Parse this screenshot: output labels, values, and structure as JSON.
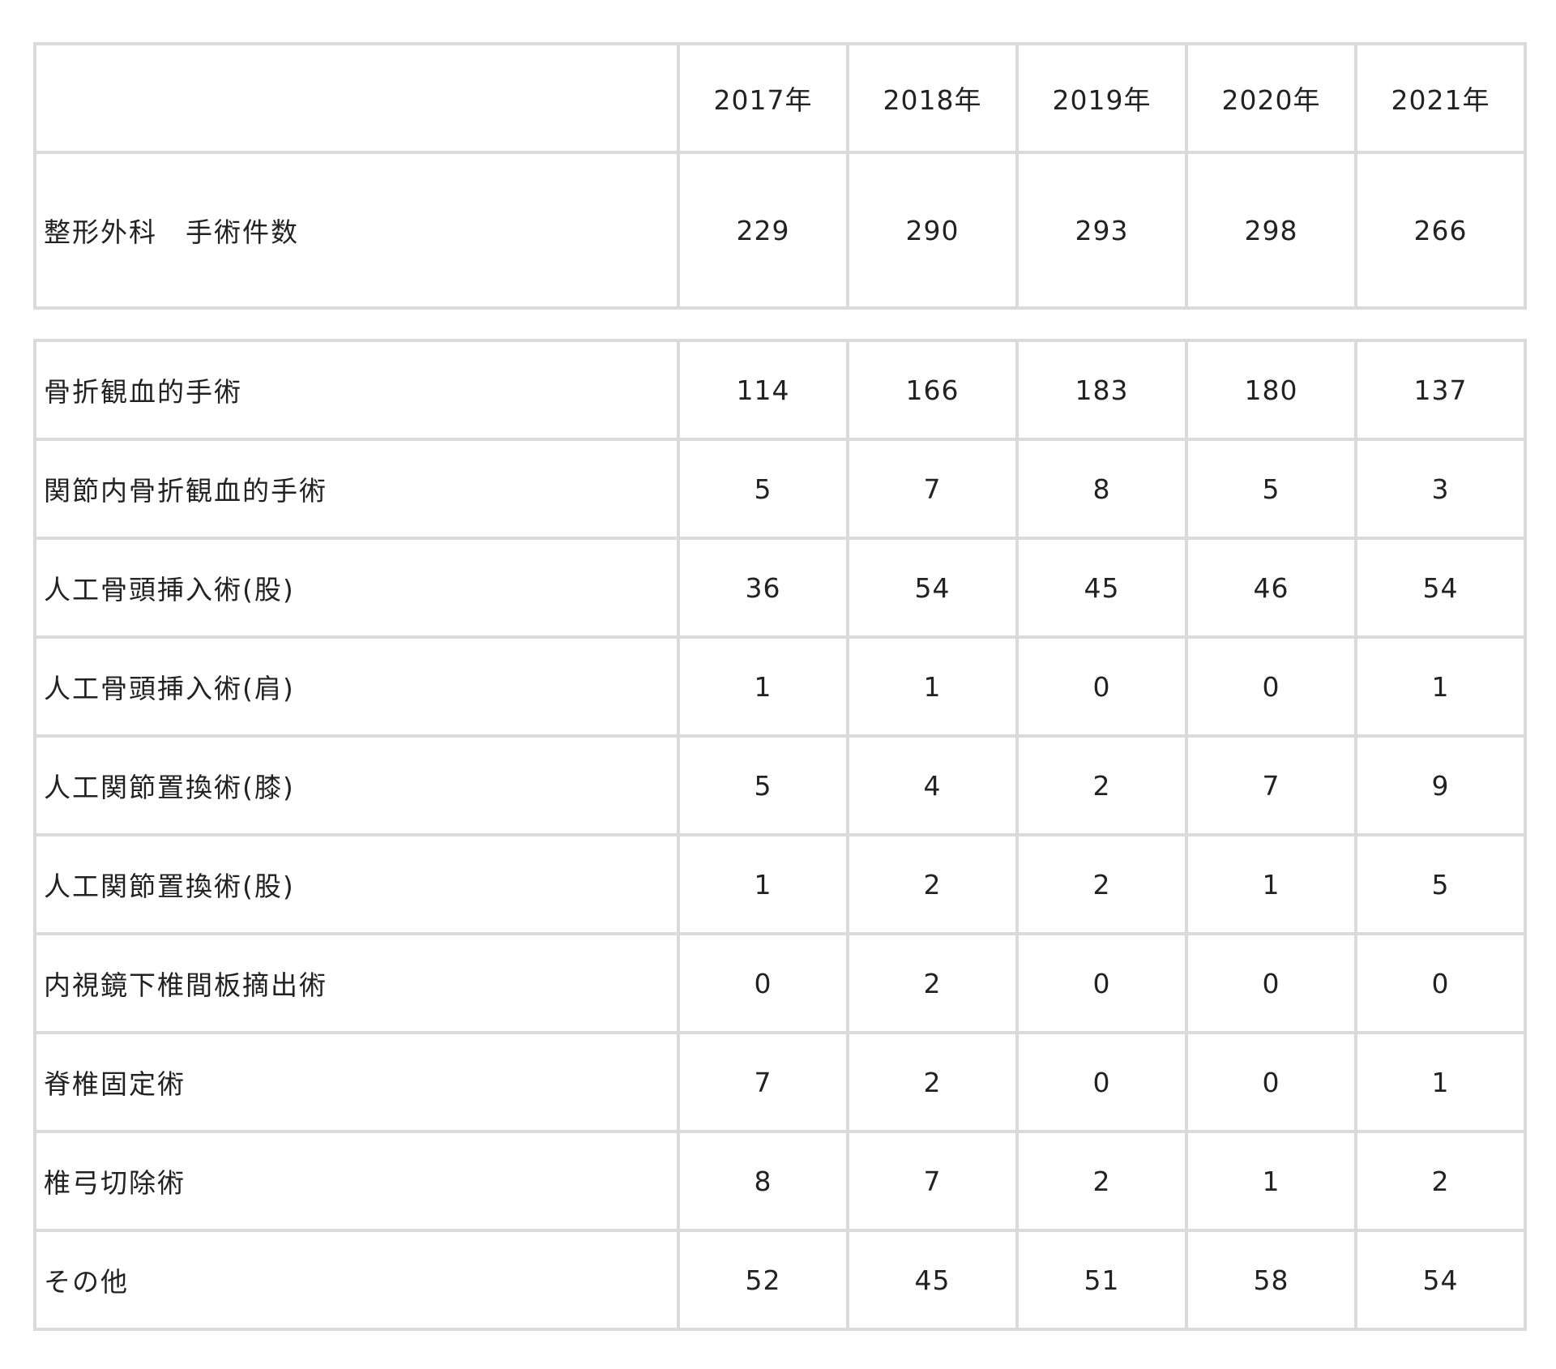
{
  "colors": {
    "border": "#dadada",
    "text": "#222222",
    "background": "#ffffff"
  },
  "summary": {
    "corner_label": "",
    "years": [
      "2017年",
      "2018年",
      "2019年",
      "2020年",
      "2021年"
    ],
    "total_label": "整形外科　手術件数",
    "total_values": [
      "229",
      "290",
      "293",
      "298",
      "266"
    ]
  },
  "details": [
    {
      "label": "骨折観血的手術",
      "values": [
        "114",
        "166",
        "183",
        "180",
        "137"
      ]
    },
    {
      "label": "関節内骨折観血的手術",
      "values": [
        "5",
        "7",
        "8",
        "5",
        "3"
      ]
    },
    {
      "label": "人工骨頭挿入術(股)",
      "values": [
        "36",
        "54",
        "45",
        "46",
        "54"
      ]
    },
    {
      "label": "人工骨頭挿入術(肩)",
      "values": [
        "1",
        "1",
        "0",
        "0",
        "1"
      ]
    },
    {
      "label": "人工関節置換術(膝)",
      "values": [
        "5",
        "4",
        "2",
        "7",
        "9"
      ]
    },
    {
      "label": "人工関節置換術(股)",
      "values": [
        "1",
        "2",
        "2",
        "1",
        "5"
      ]
    },
    {
      "label": "内視鏡下椎間板摘出術",
      "values": [
        "0",
        "2",
        "0",
        "0",
        "0"
      ]
    },
    {
      "label": "脊椎固定術",
      "values": [
        "7",
        "2",
        "0",
        "0",
        "1"
      ]
    },
    {
      "label": "椎弓切除術",
      "values": [
        "8",
        "7",
        "2",
        "1",
        "2"
      ]
    },
    {
      "label": "その他",
      "values": [
        "52",
        "45",
        "51",
        "58",
        "54"
      ]
    }
  ]
}
